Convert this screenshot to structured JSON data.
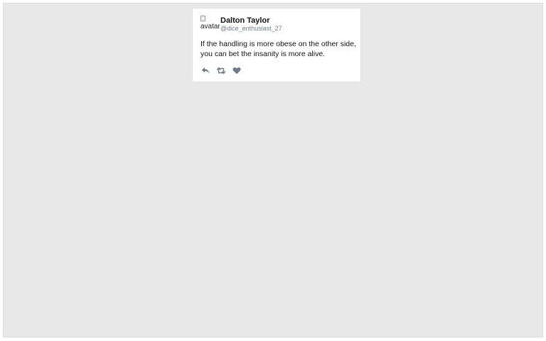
{
  "tweet": {
    "avatar_alt": "avatar",
    "display_name": "Dalton Taylor",
    "handle": "@dice_enthusiast_27",
    "text": "If the handling is more obese on the other side, you can bet the insanity is more alive.",
    "actions": [
      {
        "icon": "reply-icon"
      },
      {
        "icon": "retweet-icon"
      },
      {
        "icon": "like-icon"
      }
    ]
  },
  "colors": {
    "background": "#e8e8e8",
    "card": "#ffffff",
    "icon": "#6d7c86",
    "handle": "#6d7c86"
  }
}
